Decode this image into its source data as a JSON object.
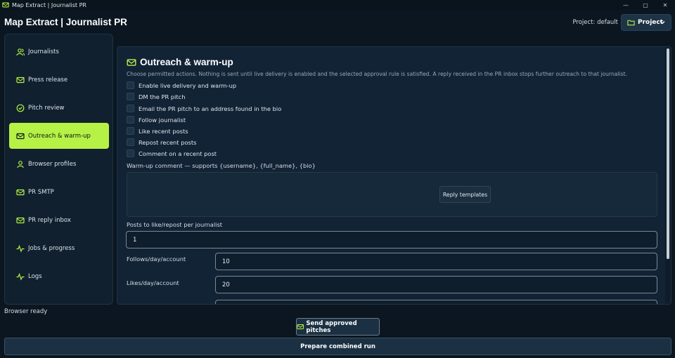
{
  "window": {
    "title": "Map Extract | Journalist PR",
    "controls": [
      "—",
      "▢",
      "✕"
    ]
  },
  "header": {
    "heading": "Map Extract | Journalist PR",
    "project_label": "Project: default",
    "project_button": "Project"
  },
  "sidebar": {
    "items": [
      {
        "label": "Journalists",
        "icon": "users-icon"
      },
      {
        "label": "Press release",
        "icon": "mail-icon"
      },
      {
        "label": "Pitch review",
        "icon": "check-circle-icon"
      },
      {
        "label": "Outreach & warm-up",
        "icon": "mail-icon"
      },
      {
        "label": "Browser profiles",
        "icon": "user-icon"
      },
      {
        "label": "PR SMTP",
        "icon": "mail-icon"
      },
      {
        "label": "PR reply inbox",
        "icon": "mail-icon"
      },
      {
        "label": "Jobs & progress",
        "icon": "activity-icon"
      },
      {
        "label": "Logs",
        "icon": "activity-icon"
      }
    ]
  },
  "outreach": {
    "title": "Outreach & warm-up",
    "description": "Choose permitted actions. Nothing is sent until live delivery is enabled and the selected approval rule is satisfied. A reply received in the PR inbox stops further outreach to that journalist.",
    "options": [
      {
        "label": "Enable live delivery and warm-up",
        "checked": false
      },
      {
        "label": "DM the PR pitch",
        "checked": false
      },
      {
        "label": "Email the PR pitch to an address found in the bio",
        "checked": false
      },
      {
        "label": "Follow journalist",
        "checked": false
      },
      {
        "label": "Like recent posts",
        "checked": false
      },
      {
        "label": "Repost recent posts",
        "checked": false
      },
      {
        "label": "Comment on a recent post",
        "checked": false
      }
    ],
    "comment_label": "Warm-up comment — supports {username}, {full_name}, {bio}",
    "reply_templates_button": "Reply templates",
    "posts_label": "Posts to like/repost per journalist",
    "posts_value": "1",
    "follows_label": "Follows/day/account",
    "follows_value": "10",
    "likes_label": "Likes/day/account",
    "likes_value": "20"
  },
  "footer": {
    "status": "Browser ready",
    "send_button": "Send approved pitches",
    "prepare_button": "Prepare combined run"
  },
  "colors": {
    "accent": "#b6f245",
    "background": "#0b1621",
    "panel": "#122336"
  }
}
